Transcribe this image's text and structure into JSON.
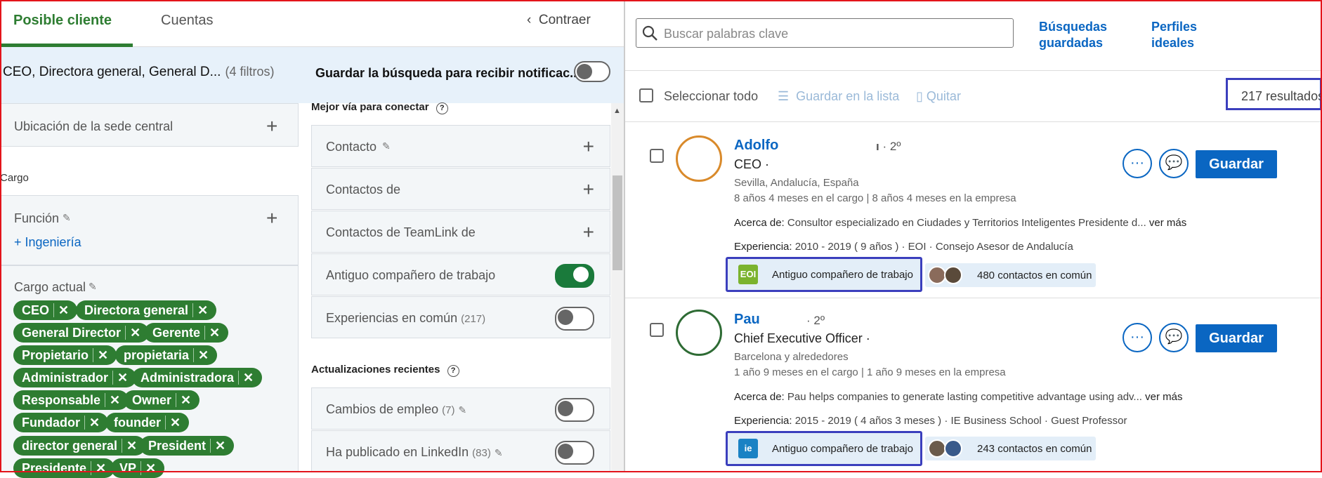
{
  "tabs": {
    "active": "Posible cliente",
    "second": "Cuentas",
    "collapse": "Contraer"
  },
  "filters_bar": {
    "summary": "CEO, Directora general, General D...",
    "count": "(4 filtros)",
    "save_search": "Guardar la búsqueda para recibir notificac..."
  },
  "left_filters": {
    "hq_location": "Ubicación de la sede central",
    "section_cargo": "Cargo",
    "function_label": "Función",
    "function_value": "Ingeniería",
    "current_title_label": "Cargo actual",
    "chips": [
      "CEO",
      "Directora general",
      "General Director",
      "Gerente",
      "Propietario",
      "propietaria",
      "Administrador",
      "Administradora",
      "Responsable",
      "Owner",
      "Fundador",
      "founder",
      "director general",
      "President",
      "Presidente",
      "VP"
    ]
  },
  "middle_filters": {
    "best_way_header": "Mejor vía para conectar",
    "items": [
      {
        "label": "Contacto",
        "control": "plus"
      },
      {
        "label": "Contactos de",
        "control": "plus"
      },
      {
        "label": "Contactos de TeamLink de",
        "control": "plus"
      },
      {
        "label": "Antiguo compañero de trabajo",
        "control": "toggle-on"
      },
      {
        "label": "Experiencias en común",
        "count": "(217)",
        "control": "toggle-off"
      }
    ],
    "recent_header": "Actualizaciones recientes",
    "recent_items": [
      {
        "label": "Cambios de empleo",
        "count": "(7)",
        "control": "toggle-off"
      },
      {
        "label": "Ha publicado en LinkedIn",
        "count": "(83)",
        "control": "toggle-off"
      }
    ]
  },
  "search": {
    "placeholder": "Buscar palabras clave",
    "saved_searches_1": "Búsquedas",
    "saved_searches_2": "guardadas",
    "ideal_profiles_1": "Perfiles",
    "ideal_profiles_2": "ideales"
  },
  "toolbar": {
    "select_all": "Seleccionar todo",
    "save_to_list": "Guardar en la lista",
    "remove": "Quitar",
    "results": "217 resultados"
  },
  "results": [
    {
      "name": "Adolfo",
      "degree": "· 2º",
      "degree_mark": "ı",
      "title": "CEO ·",
      "location": "Sevilla, Andalucía, España",
      "tenure": "8 años 4 meses en el cargo | 8 años 4 meses en la empresa",
      "about_label": "Acerca de:",
      "about": "Consultor especializado en Ciudades y Territorios Inteligentes Presidente d...",
      "more": "ver más",
      "exp_label": "Experiencia:",
      "experience": "2010 - 2019  ( 9 años ) · EOI · Consejo Asesor de Andalucía",
      "badge_logo": "EOI",
      "badge": "Antiguo compañero de trabajo",
      "shared": "480 contactos en común",
      "save": "Guardar",
      "more_icon": "···"
    },
    {
      "name": "Pau",
      "degree": "· 2º",
      "degree_mark": "",
      "title": "Chief Executive Officer ·",
      "location": "Barcelona y alrededores",
      "tenure": "1 año 9 meses en el cargo | 1 año 9 meses en la empresa",
      "about_label": "Acerca de:",
      "about": "Pau helps companies to generate lasting competitive advantage using adv...",
      "more": "ver más",
      "exp_label": "Experiencia:",
      "experience": "2015 - 2019  ( 4 años 3 meses ) · IE Business School · Guest Professor",
      "badge_logo": "ie",
      "badge": "Antiguo compañero de trabajo",
      "shared": "243 contactos en común",
      "save": "Guardar",
      "more_icon": "···"
    }
  ],
  "colors": {
    "green": "#2e7d32",
    "blue": "#0a66c2",
    "highlight": "#3b3fbd",
    "frame": "#e3141b"
  }
}
